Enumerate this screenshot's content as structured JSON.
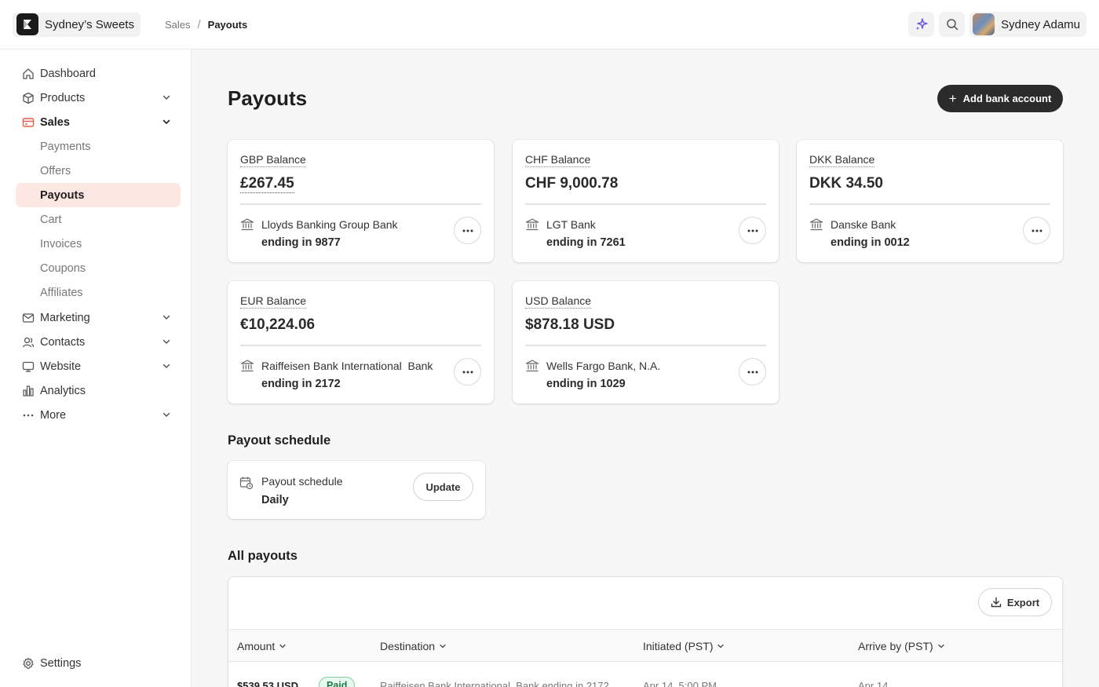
{
  "header": {
    "brand_name": "Sydney’s Sweets",
    "breadcrumb": [
      "Sales",
      "Payouts"
    ],
    "breadcrumb_separator": "/",
    "user_name": "Sydney Adamu",
    "icons": [
      "sparkle-icon",
      "search-icon"
    ]
  },
  "sidebar": {
    "items": [
      {
        "label": "Dashboard",
        "icon": "home-icon"
      },
      {
        "label": "Products",
        "icon": "box-icon",
        "expandable": true
      },
      {
        "label": "Sales",
        "icon": "credit-card-icon",
        "expandable": true,
        "expanded": true
      },
      {
        "label": "Payments"
      },
      {
        "label": "Offers"
      },
      {
        "label": "Payouts",
        "active": true
      },
      {
        "label": "Cart"
      },
      {
        "label": "Invoices"
      },
      {
        "label": "Coupons"
      },
      {
        "label": "Affiliates"
      },
      {
        "label": "Marketing",
        "icon": "mail-icon",
        "expandable": true
      },
      {
        "label": "Contacts",
        "icon": "users-icon",
        "expandable": true
      },
      {
        "label": "Website",
        "icon": "monitor-icon",
        "expandable": true
      },
      {
        "label": "Analytics",
        "icon": "bar-chart-icon"
      },
      {
        "label": "More",
        "icon": "ellipsis-icon",
        "expandable": true
      }
    ],
    "settings_label": "Settings"
  },
  "main": {
    "title": "Payouts",
    "add_bank_label": "Add bank account",
    "balances": [
      {
        "label": "GBP Balance",
        "amount": "£267.45",
        "bank": "Lloyds Banking Group Bank",
        "ending": "ending in 9877"
      },
      {
        "label": "CHF Balance",
        "amount": "CHF 9,000.78",
        "bank": "LGT Bank",
        "ending": "ending in 7261"
      },
      {
        "label": "DKK Balance",
        "amount": "DKK 34.50",
        "bank": "Danske Bank",
        "ending": "ending in 0012"
      },
      {
        "label": "EUR Balance",
        "amount": "€10,224.06",
        "bank": "Raiffeisen Bank International  Bank",
        "ending": "ending in 2172"
      },
      {
        "label": "USD Balance",
        "amount": "$878.18 USD",
        "bank": "Wells Fargo Bank, N.A.",
        "ending": "ending in 1029"
      }
    ],
    "schedule": {
      "section_title": "Payout schedule",
      "label": "Payout schedule",
      "value": "Daily",
      "update_label": "Update"
    },
    "payouts": {
      "section_title": "All payouts",
      "export_label": "Export",
      "columns": [
        "Amount",
        "Destination",
        "Initiated (PST)",
        "Arrive by (PST)"
      ],
      "rows": [
        {
          "amount": "$539.53 USD",
          "status": "Paid",
          "destination": "Raiffeisen Bank International  Bank ending in 2172",
          "initiated": "Apr 14, 5:00 PM",
          "arrive_by": "Apr 14"
        }
      ]
    }
  },
  "colors": {
    "accent": "#e8584a",
    "active_bg": "#fde7e3",
    "primary_button": "#2b2b2b",
    "paid_green": "#1d7a45",
    "sparkle": "#6a4fe0"
  }
}
